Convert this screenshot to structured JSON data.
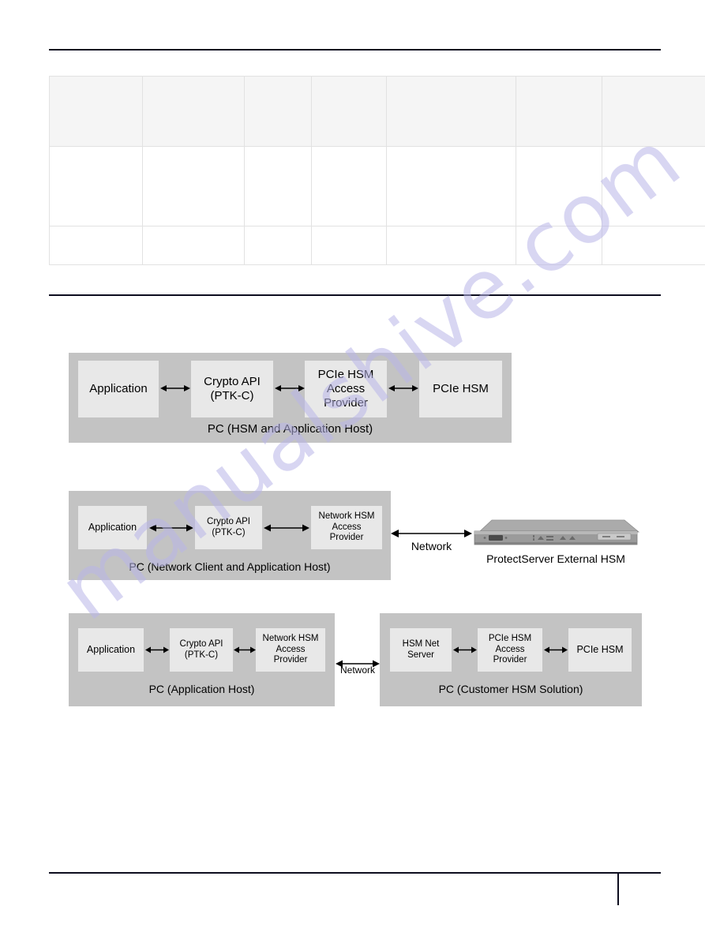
{
  "page": {
    "watermark": "manualshive.com",
    "rules": {
      "header_rule": "header-divider",
      "mid_rule": "section-divider",
      "footer_rule": "footer-divider"
    }
  },
  "table": {
    "name": "specifications-table",
    "columns": [
      "",
      "",
      "",
      "",
      "",
      "",
      ""
    ],
    "header_row": [
      "",
      "",
      "",
      "",
      "",
      "",
      ""
    ],
    "rows": [
      [
        "",
        "",
        "",
        "",
        "",
        "",
        ""
      ],
      [
        "",
        "",
        "",
        "",
        "",
        "",
        ""
      ]
    ]
  },
  "diagrams": [
    {
      "id": "pcie-hsm-local",
      "host_caption": "PC (HSM and Application Host)",
      "nodes": [
        {
          "label": "Application"
        },
        {
          "label": "Crypto API\n(PTK-C)",
          "line1": "Crypto API",
          "line2": "(PTK-C)"
        },
        {
          "label": "PCIe HSM Access Provider",
          "line1": "PCIe HSM",
          "line2": "Access",
          "line3": "Provider"
        },
        {
          "label": "PCIe HSM"
        }
      ],
      "connectors": [
        "bidirectional-arrow",
        "bidirectional-arrow",
        "bidirectional-arrow"
      ]
    },
    {
      "id": "network-hsm-external",
      "host_caption": "PC (Network Client and Application Host)",
      "nodes": [
        {
          "label": "Application"
        },
        {
          "label": "Crypto API\n(PTK-C)",
          "line1": "Crypto API",
          "line2": "(PTK-C)"
        },
        {
          "label": "Network HSM Access Provider",
          "line1": "Network HSM",
          "line2": "Access",
          "line3": "Provider"
        }
      ],
      "network_label": "Network",
      "appliance_caption": "ProtectServer External HSM",
      "connectors": [
        "bidirectional-arrow",
        "bidirectional-arrow",
        "bidirectional-arrow"
      ]
    },
    {
      "id": "customer-hsm-solution",
      "host_caption_left": "PC (Application Host)",
      "host_caption_right": "PC (Customer HSM Solution)",
      "network_label": "Network",
      "left_nodes": [
        {
          "label": "Application"
        },
        {
          "label": "Crypto API\n(PTK-C)",
          "line1": "Crypto API",
          "line2": "(PTK-C)"
        },
        {
          "label": "Network HSM Access Provider",
          "line1": "Network HSM",
          "line2": "Access",
          "line3": "Provider"
        }
      ],
      "right_nodes": [
        {
          "label": "HSM Net Server",
          "line1": "HSM Net",
          "line2": "Server"
        },
        {
          "label": "PCIe HSM Access Provider",
          "line1": "PCIe HSM",
          "line2": "Access",
          "line3": "Provider"
        },
        {
          "label": "PCIe HSM"
        }
      ],
      "connectors": [
        "bidirectional-arrow",
        "bidirectional-arrow",
        "bidirectional-arrow",
        "bidirectional-arrow",
        "bidirectional-arrow"
      ]
    }
  ],
  "colors": {
    "host_background": "#c3c3c3",
    "node_background": "#e8e8e8",
    "rule": "#0d0d1f",
    "table_border": "#e2e2e2",
    "table_header_background": "#f5f5f5",
    "watermark": "#b9b6e8"
  }
}
